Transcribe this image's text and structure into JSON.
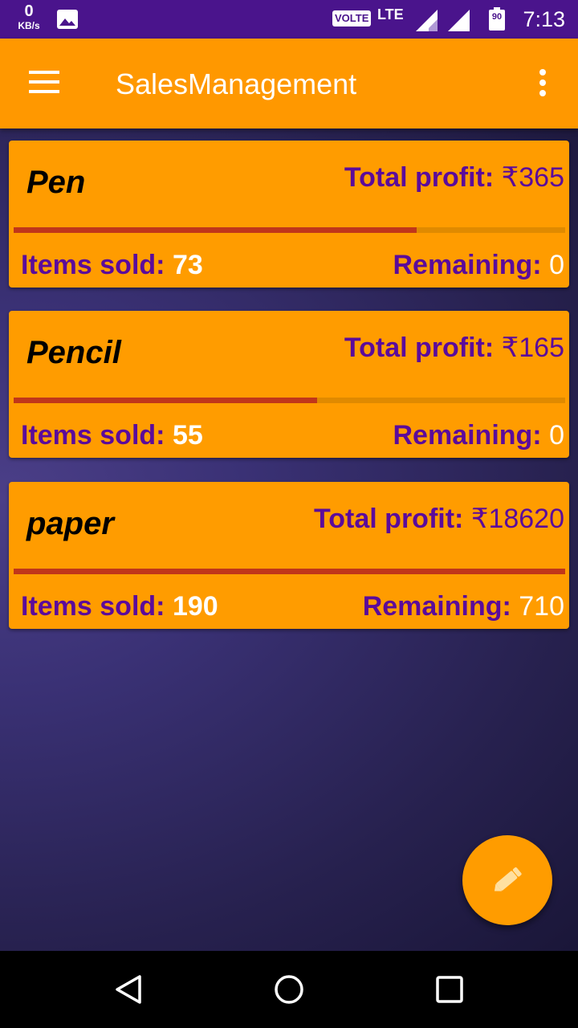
{
  "status_bar": {
    "net_speed": "0",
    "net_unit": "KB/s",
    "volte": "VOLTE",
    "network": "LTE",
    "battery": "90",
    "time": "7:13",
    "icons": [
      "gallery-icon",
      "signal-icon",
      "battery-icon"
    ]
  },
  "app_bar": {
    "title": "SalesManagement",
    "color": "#ff9800",
    "icons": [
      "menu-icon",
      "more-vert-icon"
    ]
  },
  "products": [
    {
      "name": "Pen",
      "profit_label": "Total profit: ",
      "profit_value": "₹365",
      "sold_label": "Items sold: ",
      "sold_value": "73",
      "remaining_label": "Remaining: ",
      "remaining_value": "0",
      "progress_fraction": 0.73
    },
    {
      "name": "Pencil",
      "profit_label": "Total profit: ",
      "profit_value": "₹165",
      "sold_label": "Items sold: ",
      "sold_value": "55",
      "remaining_label": "Remaining: ",
      "remaining_value": "0",
      "progress_fraction": 0.55
    },
    {
      "name": "paper",
      "profit_label": "Total profit: ",
      "profit_value": "₹18620",
      "sold_label": "Items sold: ",
      "sold_value": "190",
      "remaining_label": "Remaining: ",
      "remaining_value": "710",
      "progress_fraction": 1.0
    }
  ],
  "fab": {
    "icon": "pencil-icon",
    "color": "#ff9c00"
  },
  "nav_bar": {
    "icons": [
      "back-icon",
      "home-icon",
      "recents-icon"
    ]
  }
}
